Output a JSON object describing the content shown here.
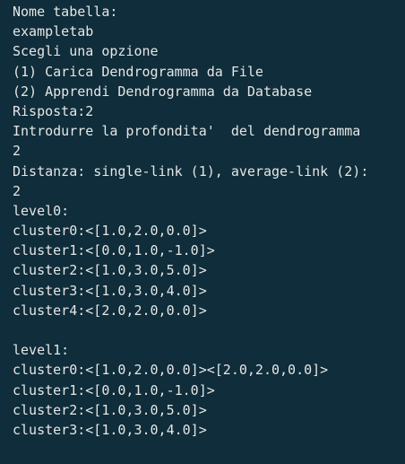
{
  "terminal": {
    "lines": [
      "Nome tabella:",
      "exampletab",
      "Scegli una opzione",
      "(1) Carica Dendrogramma da File",
      "(2) Apprendi Dendrogramma da Database",
      "Risposta:2",
      "Introdurre la profondita'  del dendrogramma",
      "2",
      "Distanza: single-link (1), average-link (2):",
      "2",
      "level0:",
      "cluster0:<[1.0,2.0,0.0]>",
      "cluster1:<[0.0,1.0,-1.0]>",
      "cluster2:<[1.0,3.0,5.0]>",
      "cluster3:<[1.0,3.0,4.0]>",
      "cluster4:<[2.0,2.0,0.0]>",
      "",
      "level1:",
      "cluster0:<[1.0,2.0,0.0]><[2.0,2.0,0.0]>",
      "cluster1:<[0.0,1.0,-1.0]>",
      "cluster2:<[1.0,3.0,5.0]>",
      "cluster3:<[1.0,3.0,4.0]>"
    ]
  }
}
